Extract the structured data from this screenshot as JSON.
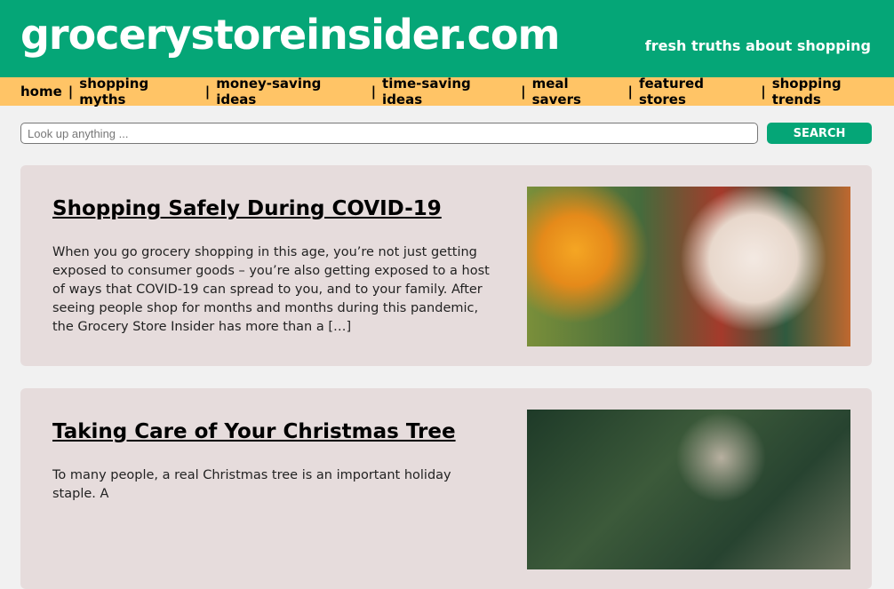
{
  "header": {
    "logo": "grocerystoreinsider.com",
    "tagline": "fresh truths about shopping"
  },
  "nav": [
    "home",
    "shopping myths",
    "money-saving ideas",
    "time-saving ideas",
    "meal savers",
    "featured stores",
    "shopping trends"
  ],
  "nav_sep": "|",
  "search": {
    "placeholder": "Look up anything ...",
    "button": "SEARCH"
  },
  "articles": [
    {
      "title": "Shopping Safely During COVID-19",
      "excerpt": "When you go grocery shopping in this age, you’re not just getting exposed to consumer goods – you’re also getting exposed to a host of ways that COVID-19 can spread to you, and to your family. After seeing people shop for months and months during this pandemic, the Grocery Store Insider has more than a […]"
    },
    {
      "title": "Taking Care of Your Christmas Tree",
      "excerpt": "To many people, a real Christmas tree is an important holiday staple. A"
    }
  ]
}
